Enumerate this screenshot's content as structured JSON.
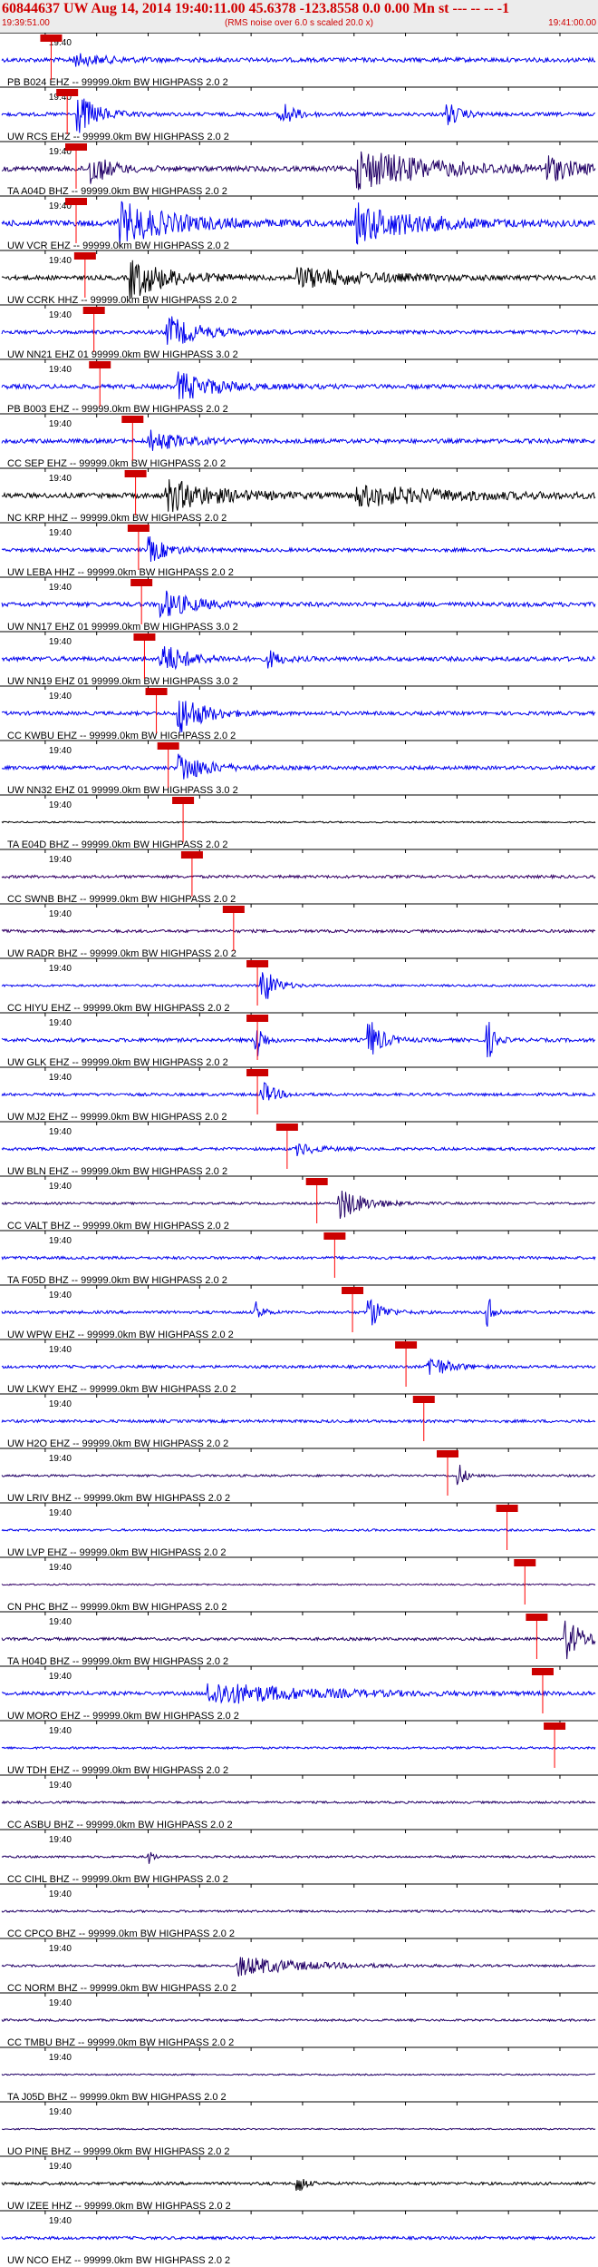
{
  "header": {
    "title": "60844637 UW Aug 14, 2014 19:40:11.00   45.6378 -123.8558  0.0 0.00 Mn st --- -- -- -1",
    "start_time": "19:39:51.00",
    "subtitle": "(RMS noise over 6.0 s scaled 20.0 x)",
    "end_time": "19:41:00.00"
  },
  "chart_data": {
    "type": "line",
    "time_range": [
      "19:39:51.00",
      "19:41:00.00"
    ],
    "time_tick_label": "19:40",
    "traces": [
      {
        "label": "PB B024 EHZ -- 99999.0km BW  HIGHPASS  2.0  2",
        "color": "#0000ee",
        "pick": 0.083,
        "amp": 0.6,
        "events": [
          [
            0.12,
            0.3,
            0.05
          ]
        ]
      },
      {
        "label": "UW RCS EHZ -- 99999.0km BW  HIGHPASS  2.0  2",
        "color": "#0000ee",
        "pick": 0.11,
        "amp": 0.5,
        "events": [
          [
            0.13,
            1.0,
            0.03
          ],
          [
            0.47,
            0.7,
            0.02
          ],
          [
            0.75,
            0.6,
            0.02
          ]
        ]
      },
      {
        "label": "TA A04D BHZ -- 99999.0km BW  HIGHPASS  2.0  2",
        "color": "#220066",
        "pick": 0.125,
        "amp": 0.7,
        "events": [
          [
            0.15,
            0.8,
            0.03
          ],
          [
            0.6,
            1.0,
            0.12
          ],
          [
            0.92,
            0.6,
            0.04
          ]
        ]
      },
      {
        "label": "UW VCR EHZ -- 99999.0km BW  HIGHPASS  2.0  2",
        "color": "#0000ee",
        "pick": 0.125,
        "amp": 0.8,
        "events": [
          [
            0.2,
            1.0,
            0.09
          ],
          [
            0.6,
            0.9,
            0.1
          ]
        ]
      },
      {
        "label": "UW CCRK HHZ -- 99999.0km BW  HIGHPASS  2.0  2",
        "color": "#000000",
        "pick": 0.14,
        "amp": 0.6,
        "events": [
          [
            0.22,
            1.0,
            0.06
          ],
          [
            0.5,
            0.5,
            0.12
          ]
        ]
      },
      {
        "label": "UW NN21 EHZ 01 99999.0km BW  HIGHPASS  3.0  2",
        "color": "#0000ee",
        "pick": 0.155,
        "amp": 0.5,
        "events": [
          [
            0.28,
            0.8,
            0.05
          ]
        ]
      },
      {
        "label": "PB B003 EHZ -- 99999.0km BW  HIGHPASS  2.0  2",
        "color": "#0000ee",
        "pick": 0.165,
        "amp": 0.6,
        "events": [
          [
            0.3,
            0.7,
            0.06
          ]
        ]
      },
      {
        "label": "CC SEP EHZ -- 99999.0km BW  HIGHPASS  2.0  2",
        "color": "#0000ee",
        "pick": 0.22,
        "amp": 0.6,
        "events": [
          [
            0.25,
            0.5,
            0.05
          ]
        ]
      },
      {
        "label": "NC KRP HHZ -- 99999.0km BW  HIGHPASS  2.0  2",
        "color": "#000000",
        "pick": 0.225,
        "amp": 0.7,
        "events": [
          [
            0.28,
            0.8,
            0.08
          ],
          [
            0.6,
            0.5,
            0.15
          ]
        ]
      },
      {
        "label": "UW LEBA HHZ -- 99999.0km BW  HIGHPASS  2.0  2",
        "color": "#0000ee",
        "pick": 0.23,
        "amp": 0.5,
        "events": [
          [
            0.25,
            0.6,
            0.03
          ]
        ]
      },
      {
        "label": "UW NN17 EHZ 01 99999.0km BW  HIGHPASS  3.0  2",
        "color": "#0000ee",
        "pick": 0.235,
        "amp": 0.6,
        "events": [
          [
            0.27,
            0.7,
            0.05
          ]
        ]
      },
      {
        "label": "UW NN19 EHZ 01 99999.0km BW  HIGHPASS  3.0  2",
        "color": "#0000ee",
        "pick": 0.24,
        "amp": 0.6,
        "events": [
          [
            0.27,
            0.8,
            0.04
          ],
          [
            0.45,
            0.4,
            0.02
          ]
        ]
      },
      {
        "label": "CC KWBU EHZ -- 99999.0km BW  HIGHPASS  2.0  2",
        "color": "#0000ee",
        "pick": 0.26,
        "amp": 0.5,
        "events": [
          [
            0.3,
            1.0,
            0.04
          ]
        ]
      },
      {
        "label": "UW NN32 EHZ 01 99999.0km BW  HIGHPASS  3.0  2",
        "color": "#0000ee",
        "pick": 0.28,
        "amp": 0.5,
        "events": [
          [
            0.3,
            0.8,
            0.04
          ]
        ]
      },
      {
        "label": "TA E04D BHZ -- 99999.0km BW  HIGHPASS  2.0  2",
        "color": "#000000",
        "pick": 0.305,
        "amp": 0.2,
        "events": []
      },
      {
        "label": "CC SWNB BHZ -- 99999.0km BW  HIGHPASS  2.0  2",
        "color": "#330066",
        "pick": 0.32,
        "amp": 0.4,
        "events": []
      },
      {
        "label": "UW RADR BHZ -- 99999.0km BW  HIGHPASS  2.0  2",
        "color": "#330066",
        "pick": 0.39,
        "amp": 0.4,
        "events": []
      },
      {
        "label": "CC HIYU EHZ -- 99999.0km BW  HIGHPASS  2.0  2",
        "color": "#0000ee",
        "pick": 0.43,
        "amp": 0.3,
        "events": [
          [
            0.44,
            1.0,
            0.02
          ]
        ]
      },
      {
        "label": "UW GLK EHZ -- 99999.0km BW  HIGHPASS  2.0  2",
        "color": "#0000ee",
        "pick": 0.43,
        "amp": 0.5,
        "events": [
          [
            0.43,
            1.0,
            0.01
          ],
          [
            0.62,
            1.0,
            0.02
          ],
          [
            0.82,
            0.9,
            0.01
          ]
        ]
      },
      {
        "label": "UW MJ2 EHZ -- 99999.0km BW  HIGHPASS  2.0  2",
        "color": "#0000ee",
        "pick": 0.43,
        "amp": 0.4,
        "events": [
          [
            0.44,
            0.6,
            0.02
          ]
        ]
      },
      {
        "label": "UW BLN EHZ -- 99999.0km BW  HIGHPASS  2.0  2",
        "color": "#0000ee",
        "pick": 0.48,
        "amp": 0.4,
        "events": [
          [
            0.5,
            0.3,
            0.03
          ]
        ]
      },
      {
        "label": "CC VALT BHZ -- 99999.0km BW  HIGHPASS  2.0  2",
        "color": "#220066",
        "pick": 0.53,
        "amp": 0.3,
        "events": [
          [
            0.57,
            0.8,
            0.04
          ]
        ]
      },
      {
        "label": "TA F05D BHZ -- 99999.0km BW  HIGHPASS  2.0  2",
        "color": "#0000ee",
        "pick": 0.56,
        "amp": 0.4,
        "events": []
      },
      {
        "label": "UW WPW EHZ -- 99999.0km BW  HIGHPASS  2.0  2",
        "color": "#0000ee",
        "pick": 0.59,
        "amp": 0.4,
        "events": [
          [
            0.43,
            0.5,
            0.01
          ],
          [
            0.62,
            0.8,
            0.02
          ],
          [
            0.82,
            0.7,
            0.01
          ]
        ]
      },
      {
        "label": "UW LKWY EHZ -- 99999.0km BW  HIGHPASS  2.0  2",
        "color": "#0000ee",
        "pick": 0.68,
        "amp": 0.4,
        "events": [
          [
            0.72,
            0.6,
            0.03
          ]
        ]
      },
      {
        "label": "UW H2O EHZ -- 99999.0km BW  HIGHPASS  2.0  2",
        "color": "#0000ee",
        "pick": 0.71,
        "amp": 0.4,
        "events": []
      },
      {
        "label": "UW LRIV BHZ -- 99999.0km BW  HIGHPASS  2.0  2",
        "color": "#220066",
        "pick": 0.75,
        "amp": 0.3,
        "events": [
          [
            0.77,
            0.6,
            0.01
          ]
        ]
      },
      {
        "label": "UW LVP EHZ -- 99999.0km BW  HIGHPASS  2.0  2",
        "color": "#0000ee",
        "pick": 0.85,
        "amp": 0.3,
        "events": []
      },
      {
        "label": "CN PHC BHZ -- 99999.0km BW  HIGHPASS  2.0  2",
        "color": "#330066",
        "pick": 0.88,
        "amp": 0.2,
        "events": []
      },
      {
        "label": "TA H04D BHZ -- 99999.0km BW  HIGHPASS  2.0  2",
        "color": "#220066",
        "pick": 0.9,
        "amp": 0.4,
        "events": [
          [
            0.95,
            1.0,
            0.03
          ]
        ]
      },
      {
        "label": "UW MORO EHZ -- 99999.0km BW  HIGHPASS  2.0  2",
        "color": "#0000ee",
        "pick": 0.91,
        "amp": 0.5,
        "events": [
          [
            0.35,
            0.6,
            0.15
          ]
        ]
      },
      {
        "label": "UW TDH EHZ -- 99999.0km BW  HIGHPASS  2.0  2",
        "color": "#0000ee",
        "pick": 0.93,
        "amp": 0.3,
        "events": []
      },
      {
        "label": "CC ASBU BHZ -- 99999.0km BW  HIGHPASS  2.0  2",
        "color": "#220066",
        "pick": null,
        "amp": 0.3,
        "events": []
      },
      {
        "label": "CC CIHL BHZ -- 99999.0km BW  HIGHPASS  2.0  2",
        "color": "#220066",
        "pick": null,
        "amp": 0.3,
        "events": [
          [
            0.25,
            0.4,
            0.005
          ]
        ]
      },
      {
        "label": "CC CPCO BHZ -- 99999.0km BW  HIGHPASS  2.0  2",
        "color": "#220066",
        "pick": null,
        "amp": 0.3,
        "events": []
      },
      {
        "label": "CC NORM BHZ -- 99999.0km BW  HIGHPASS  2.0  2",
        "color": "#220066",
        "pick": null,
        "amp": 0.3,
        "events": [
          [
            0.4,
            0.5,
            0.1
          ]
        ]
      },
      {
        "label": "CC TMBU BHZ -- 99999.0km BW  HIGHPASS  2.0  2",
        "color": "#220066",
        "pick": null,
        "amp": 0.3,
        "events": []
      },
      {
        "label": "TA J05D BHZ -- 99999.0km BW  HIGHPASS  2.0  2",
        "color": "#220066",
        "pick": null,
        "amp": 0.2,
        "events": []
      },
      {
        "label": "UO PINE BHZ -- 99999.0km BW  HIGHPASS  2.0  2",
        "color": "#220066",
        "pick": null,
        "amp": 0.2,
        "events": []
      },
      {
        "label": "UW IZEE HHZ -- 99999.0km BW  HIGHPASS  2.0  2",
        "color": "#000000",
        "pick": null,
        "amp": 0.4,
        "events": [
          [
            0.5,
            0.5,
            0.01
          ]
        ]
      },
      {
        "label": "UW NCO EHZ -- 99999.0km BW  HIGHPASS  2.0  2",
        "color": "#0000ee",
        "pick": null,
        "amp": 0.4,
        "events": []
      }
    ]
  }
}
